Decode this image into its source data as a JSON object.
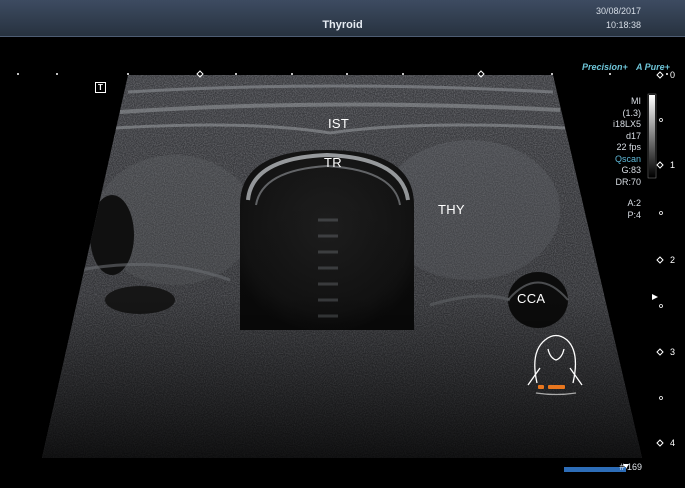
{
  "header": {
    "title": "Thyroid",
    "date": "30/08/2017",
    "time": "10:18:38"
  },
  "modes": {
    "precision": "Precision+",
    "apure": "A Pure+"
  },
  "marker_t": "T",
  "labels": {
    "ist": "IST",
    "tr": "TR",
    "thy": "THY",
    "cca": "CCA"
  },
  "settings": {
    "mi_label": "MI",
    "mi_value": "(1.3)",
    "probe": "i18LX5",
    "depth": "d17",
    "fps": "22 fps",
    "qscan": "Qscan",
    "gain": "G:83",
    "dr": "DR:70",
    "a": "A:2",
    "p": "P:4"
  },
  "depth_scale": [
    "0",
    "1",
    "2",
    "3",
    "4"
  ],
  "frame_number": "# 169",
  "colors": {
    "header": "#27323f",
    "accent": "#6ec5d8",
    "frame_bar": "#2d6db8",
    "probe_marker": "#e8761e"
  }
}
